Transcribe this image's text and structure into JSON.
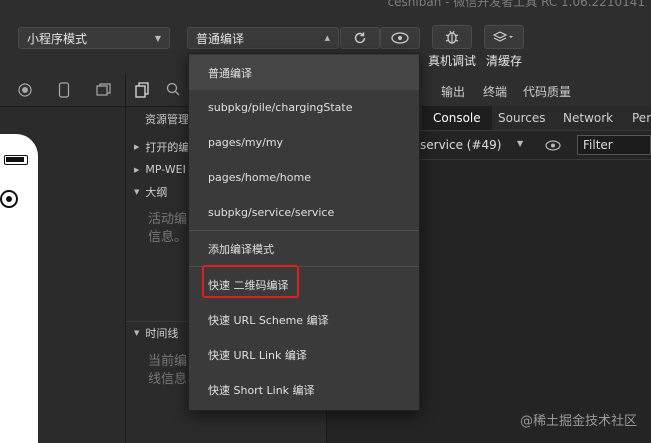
{
  "window": {
    "title_fragment": "ceshiban - 微信开发者工具 RC 1.06.2210141"
  },
  "toolbar": {
    "mode_select": "小程序模式",
    "compile_select": "普通编译",
    "real_device_debug_label": "真机调试",
    "clear_cache_label": "清缓存"
  },
  "icons": {
    "refresh": "refresh-icon",
    "preview": "eye-icon",
    "debug": "bug-icon",
    "cache": "layers-icon",
    "record": "record-icon",
    "phone": "phone-icon",
    "window": "window-icon",
    "files": "files-icon",
    "search": "search-icon"
  },
  "explorer": {
    "header": "资源管理",
    "items": [
      {
        "label": "打开的编"
      },
      {
        "label": "MP-WEI"
      },
      {
        "label": "大纲"
      }
    ],
    "outline_empty_text_line1": "活动编",
    "outline_empty_text_line2": "信息。",
    "timeline_label": "时间线",
    "timeline_empty_text_line1": "当前编",
    "timeline_empty_text_line2": "线信息"
  },
  "devtools": {
    "top_tabs": [
      "输出",
      "终端",
      "代码质量"
    ],
    "tabs": [
      "Console",
      "Sources",
      "Network",
      "Perf"
    ],
    "active_tab": "Console",
    "context_select": "service (#49)",
    "filter_placeholder": "Filter"
  },
  "dropdown": {
    "items": [
      "普通编译",
      "subpkg/pile/chargingState",
      "pages/my/my",
      "pages/home/home",
      "subpkg/service/service",
      "添加编译模式",
      "快速 二维码编译",
      "快速 URL Scheme 编译",
      "快速 URL Link 编译",
      "快速 Short Link 编译"
    ],
    "selected_index": 0,
    "highlighted_index": 6
  },
  "watermark": "@稀土掘金技术社区",
  "colors": {
    "highlight_border": "#e02020",
    "background": "#2b2b2b",
    "dropdown_bg": "#3a3a3a"
  }
}
